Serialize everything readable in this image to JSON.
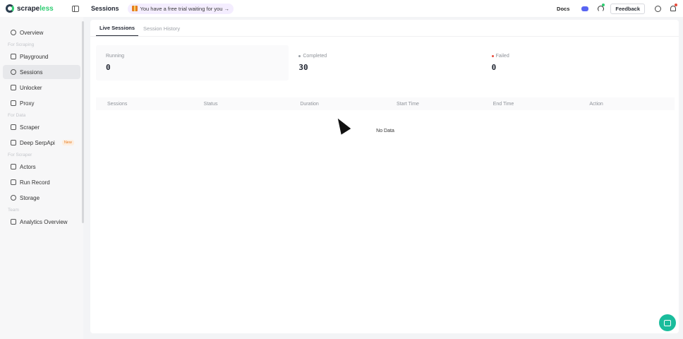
{
  "brand": {
    "name_part1": "scrape",
    "name_part2": "less"
  },
  "header": {
    "title": "Sessions",
    "trial_text": "You have a free trial waiting for you →",
    "docs": "Docs",
    "feedback": "Feedback"
  },
  "sidebar": {
    "items": [
      {
        "type": "item",
        "label": "Overview",
        "icon": "monitor-icon"
      },
      {
        "type": "section",
        "label": "For Scraping"
      },
      {
        "type": "item",
        "label": "Playground",
        "icon": "playground-icon"
      },
      {
        "type": "item",
        "label": "Sessions",
        "icon": "sessions-icon",
        "active": true
      },
      {
        "type": "item",
        "label": "Unlocker",
        "icon": "lock-icon"
      },
      {
        "type": "item",
        "label": "Proxy",
        "icon": "proxy-icon"
      },
      {
        "type": "section",
        "label": "For Data"
      },
      {
        "type": "item",
        "label": "Scraper",
        "icon": "scraper-icon"
      },
      {
        "type": "item",
        "label": "Deep SerpApi",
        "icon": "serp-icon",
        "badge": "New"
      },
      {
        "type": "section",
        "label": "For Scraper"
      },
      {
        "type": "item",
        "label": "Actors",
        "icon": "actors-icon"
      },
      {
        "type": "item",
        "label": "Run Record",
        "icon": "run-record-icon"
      },
      {
        "type": "item",
        "label": "Storage",
        "icon": "storage-icon"
      },
      {
        "type": "section",
        "label": "Team"
      },
      {
        "type": "item",
        "label": "Analytics Overview",
        "icon": "analytics-icon"
      }
    ]
  },
  "tabs": [
    {
      "label": "Live Sessions",
      "active": true
    },
    {
      "label": "Session History",
      "active": false
    }
  ],
  "stats": [
    {
      "label": "Running",
      "value": "0",
      "dot_color": ""
    },
    {
      "label": "Completed",
      "value": "30",
      "dot_color": "#9aa0a6"
    },
    {
      "label": "Failed",
      "value": "0",
      "dot_color": "#e74c3c"
    }
  ],
  "table": {
    "columns": [
      "Sessions",
      "Status",
      "Duration",
      "Start Time",
      "End Time",
      "Action"
    ],
    "empty_text": "No Data"
  }
}
